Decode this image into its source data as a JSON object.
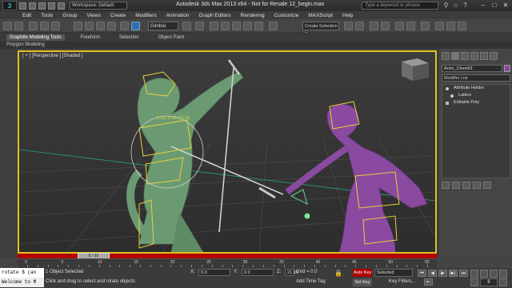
{
  "title_bar": {
    "workspace": "Workspace: Default",
    "window_title": "Autodesk 3ds Max  2013 x64  -  Not for Resale    12_begin.max",
    "search_placeholder": "Type a keyword or phrase"
  },
  "menu": [
    "Edit",
    "Tools",
    "Group",
    "Views",
    "Create",
    "Modifiers",
    "Animation",
    "Graph Editors",
    "Rendering",
    "Customize",
    "MAXScript",
    "Help"
  ],
  "toolbar": {
    "ref_coord": "Gimbal",
    "named_selection": "Create Selection Se"
  },
  "ribbon": {
    "tabs": [
      "Graphite Modeling Tools",
      "Freeform",
      "Selection",
      "Object Paint"
    ],
    "subpanel": "Polygon Modeling"
  },
  "viewport": {
    "label": "[ + ] [Perspective ] [Shaded ]",
    "transform_readout": "0.00, 0.00, 21.99"
  },
  "command_panel": {
    "object_name": "Anim_Chest01",
    "object_color": "#8a4aa0",
    "modifier_list": "Modifier List",
    "stack": [
      {
        "label": "Attribute Holder",
        "level": 0
      },
      {
        "label": "Lattice",
        "level": 0
      },
      {
        "label": "Editable Poly",
        "level": 0
      }
    ]
  },
  "timeline": {
    "current_frame_label": "6 / 55",
    "ticks": [
      "0",
      "5",
      "10",
      "15",
      "20",
      "25",
      "30",
      "35",
      "40",
      "45",
      "50",
      "55"
    ]
  },
  "status": {
    "maxscript_input": "rotate $ (an",
    "maxscript_output": "Welcome to M",
    "selection_count": "1 Object Selected",
    "prompt": "Click and drag to select and rotate objects",
    "x_label": "X:",
    "x_value": "0.0",
    "y_label": "Y:",
    "y_value": "0.0",
    "z_label": "Z:",
    "z_value": "21.99",
    "grid": "Grid = 0.0",
    "add_time_tag": "Add Time Tag",
    "auto_key": "Auto Key",
    "set_key": "Set Key",
    "key_mode": "Selected",
    "key_filters": "Key Filters...",
    "frame": "6"
  },
  "colors": {
    "green_character": "#6b9a72",
    "purple_character": "#8a4aa0",
    "rig_controls": "#e8d03a",
    "animate_mode": "#b00000"
  }
}
